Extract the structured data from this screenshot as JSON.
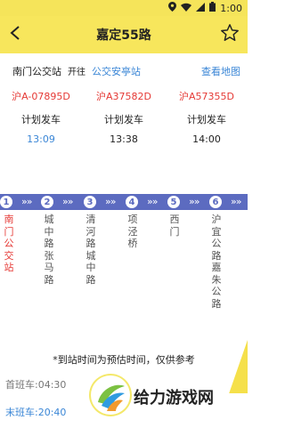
{
  "status": {
    "time": "1:00"
  },
  "header": {
    "title": "嘉定55路"
  },
  "route": {
    "start": "南门公交站",
    "direction": "开往",
    "end": "公交安亭站",
    "map_link": "查看地图"
  },
  "buses": [
    {
      "plate": "沪A-07895D",
      "status": "计划发车",
      "time": "13:09",
      "time_color": "#3a86d6"
    },
    {
      "plate": "沪A37582D",
      "status": "计划发车",
      "time": "13:38",
      "time_color": "#222222"
    },
    {
      "plate": "沪A57355D",
      "status": "计划发车",
      "time": "14:00",
      "time_color": "#222222"
    }
  ],
  "stops": [
    {
      "num": "1",
      "name": "南门公交站",
      "active": true
    },
    {
      "num": "2",
      "name": "城中路张马路",
      "active": false
    },
    {
      "num": "3",
      "name": "清河路城中路",
      "active": false
    },
    {
      "num": "4",
      "name": "项泾桥",
      "active": false
    },
    {
      "num": "5",
      "name": "西门",
      "active": false
    },
    {
      "num": "6",
      "name": "沪宜公路嘉朱公路",
      "active": false
    }
  ],
  "notice": "*到站时间为预估时间，仅供参考",
  "first_bus": "首班车:04:30",
  "last_bus": "末班车:20:40",
  "watermark": "给力游戏网",
  "colors": {
    "accent": "#f7e65c",
    "stop_bar": "#5c6bc0",
    "link": "#3a86d6",
    "alert": "#e53935"
  }
}
